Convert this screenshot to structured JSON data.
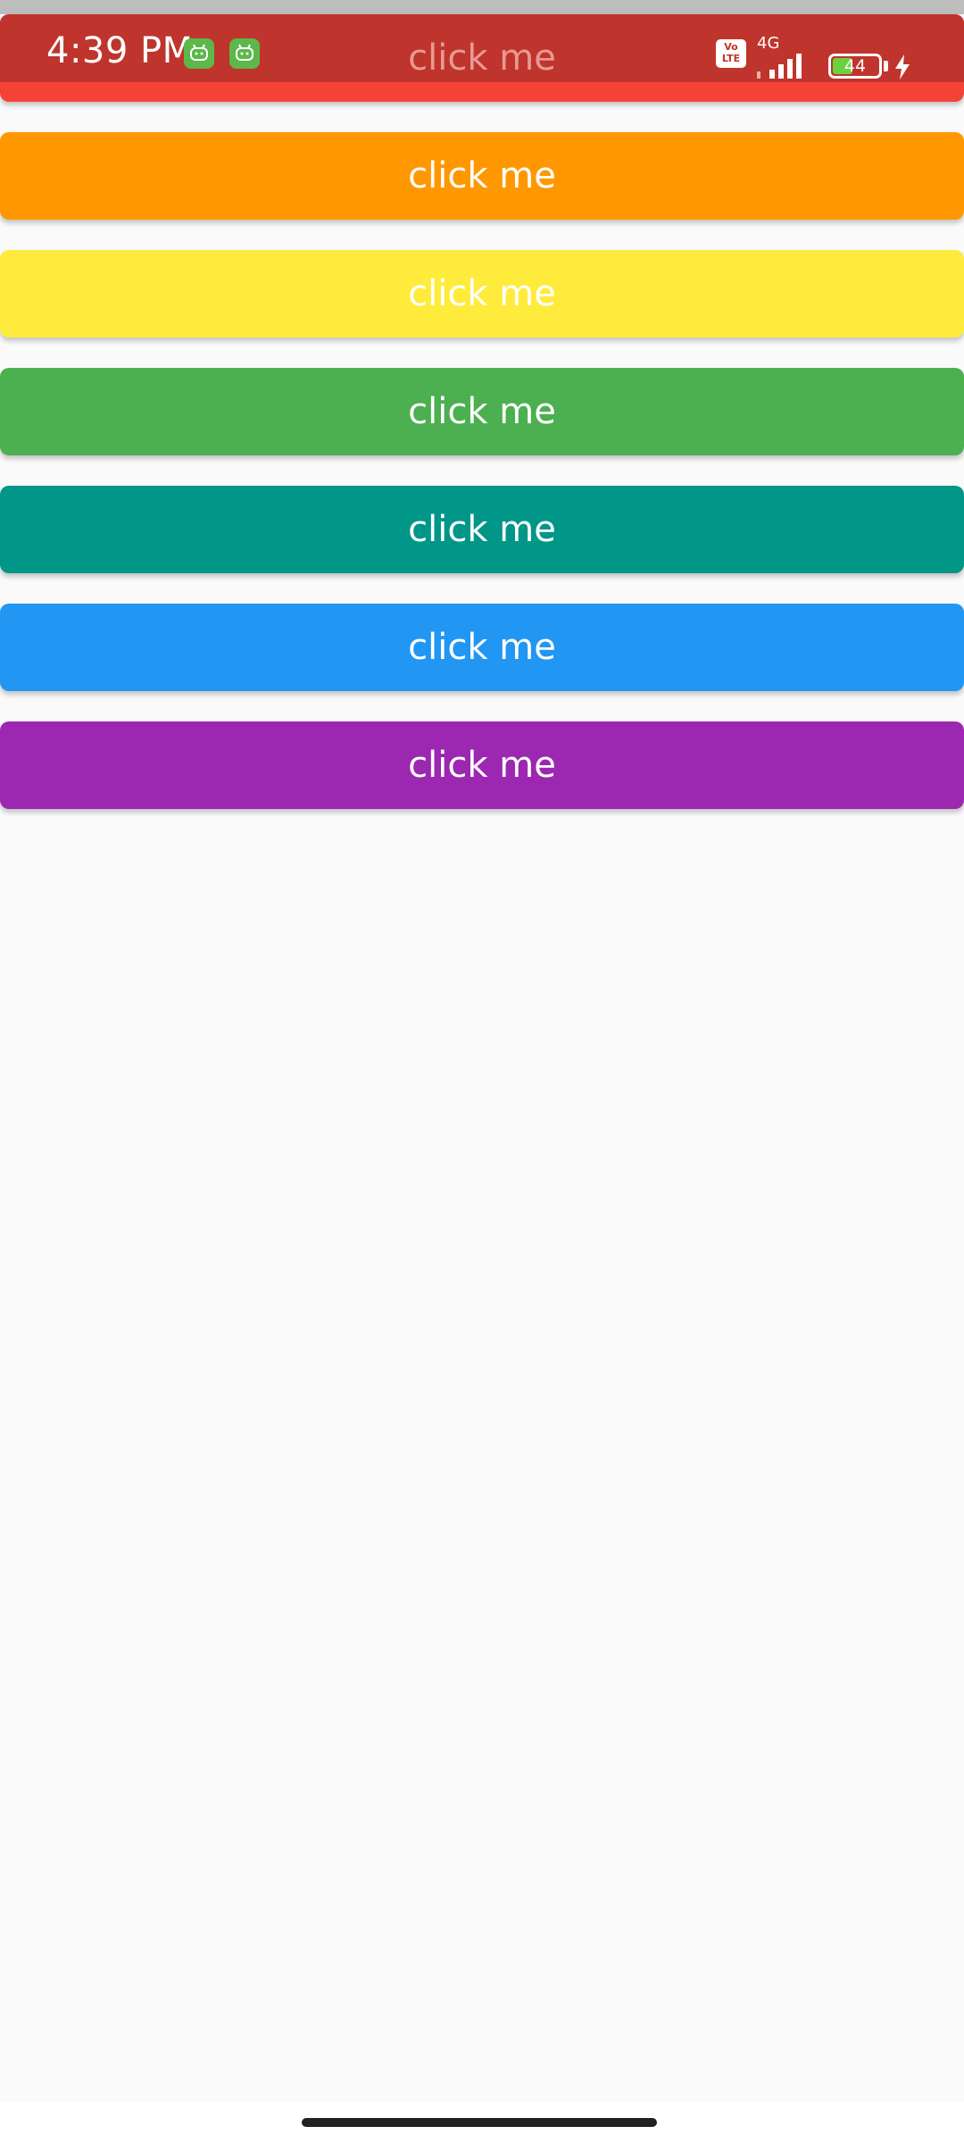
{
  "status_bar": {
    "time": "4:39 PM",
    "network": "4G",
    "volte": "Vo LTE",
    "battery_percent": 44,
    "battery_label": "44",
    "charging": true
  },
  "buttons": [
    {
      "label": "click me",
      "color": "#f44336"
    },
    {
      "label": "click me",
      "color": "#ff9800"
    },
    {
      "label": "click me",
      "color": "#ffeb3b"
    },
    {
      "label": "click me",
      "color": "#4caf50"
    },
    {
      "label": "click me",
      "color": "#009688"
    },
    {
      "label": "click me",
      "color": "#2196f3"
    },
    {
      "label": "click me",
      "color": "#9c27b0"
    }
  ],
  "colors": {
    "status_bar": "#bf342c",
    "background": "#fafafa"
  }
}
